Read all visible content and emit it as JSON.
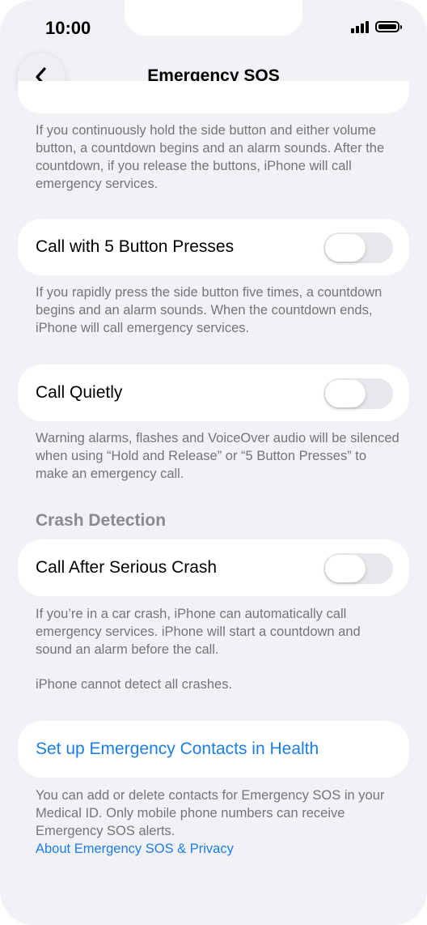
{
  "status": {
    "time": "10:00",
    "icons": [
      "cellular-signal-icon",
      "battery-icon"
    ]
  },
  "nav": {
    "title": "Emergency SOS",
    "back_icon": "chevron-left-icon"
  },
  "sections": {
    "hold_release_footer": "If you continuously hold the side button and either volume button, a countdown begins and an alarm sounds. After the countdown, if you release the buttons, iPhone will call emergency services.",
    "five_presses": {
      "label": "Call with 5 Button Presses",
      "on": false,
      "footer": "If you rapidly press the side button five times, a countdown begins and an alarm sounds. When the countdown ends, iPhone will call emergency services."
    },
    "call_quietly": {
      "label": "Call Quietly",
      "on": false,
      "footer": "Warning alarms, flashes and VoiceOver audio will be silenced when using “Hold and Release” or “5 Button Presses” to make an emergency call."
    },
    "crash_detection": {
      "header": "Crash Detection",
      "label": "Call After Serious Crash",
      "on": false,
      "footer": "If you’re in a car crash, iPhone can automatically call emergency services. iPhone will start a countdown and sound an alarm before the call.",
      "footer_note": "iPhone cannot detect all crashes."
    },
    "emergency_contacts": {
      "label": "Set up Emergency Contacts in Health",
      "footer": "You can add or delete contacts for Emergency SOS in your Medical ID. Only mobile phone numbers can receive Emergency SOS alerts.",
      "privacy_link": "About Emergency SOS & Privacy"
    }
  },
  "colors": {
    "background": "#f2f1f6",
    "card": "#ffffff",
    "link": "#1a7ee8",
    "secondary_text": "#75747c",
    "toggle_off": "#e8e7ec"
  }
}
